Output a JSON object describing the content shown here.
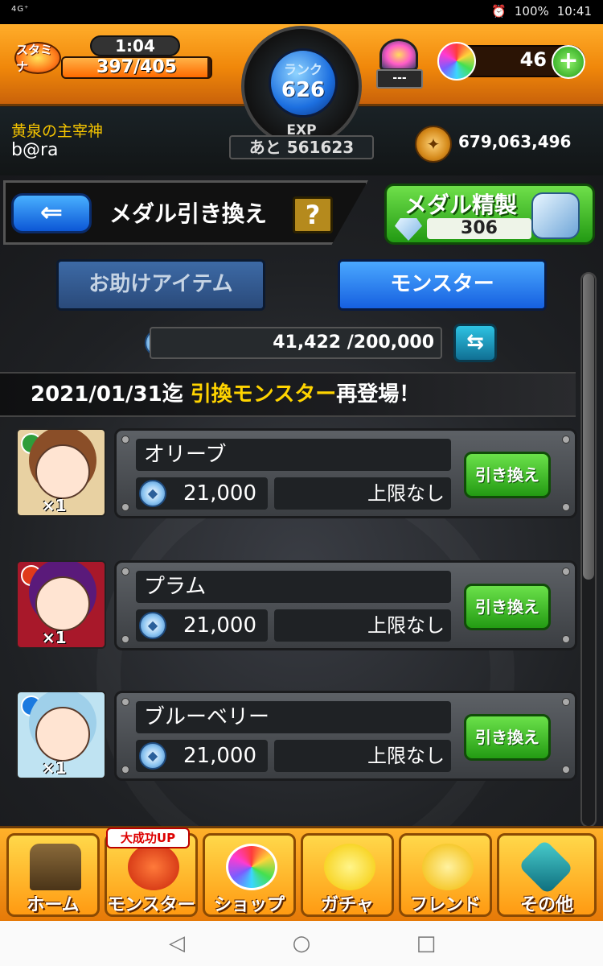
{
  "status_bar": {
    "network": "4G⁺",
    "battery": "100%",
    "time": "10:41"
  },
  "colors": {
    "accent_orange": "#f0870a",
    "button_green": "#229a13",
    "tab_blue": "#1660e0",
    "highlight_yellow": "#ffd400"
  },
  "header": {
    "stamina_badge": "スタミナ",
    "stamina_timer": "1:04",
    "stamina_value": "397/405",
    "stamina_fraction": 0.98,
    "rank_label": "ランク",
    "rank_value": "626",
    "exp_label": "EXP",
    "exp_remaining": "あと 561623",
    "helper_value": "---",
    "orb_count": "46",
    "plus_label": "+",
    "title": "黄泉の主宰神",
    "username": "b@ra",
    "coin_value": "679,063,496"
  },
  "nav": {
    "back_icon": "back-arrow-icon",
    "title": "メダル引き換え",
    "help_label": "?",
    "refine_label": "メダル精製",
    "refine_count": "306"
  },
  "tabs": {
    "items_label": "お助けアイテム",
    "monster_label": "モンスター",
    "active": "monster"
  },
  "medals": {
    "current": "41,422",
    "max": "200,000",
    "display": "41,422 /200,000",
    "swap_icon": "swap-icon"
  },
  "banner": {
    "date_text": "2021/01/31迄",
    "highlight_text": "引換モンスター",
    "suffix_text": "再登場！"
  },
  "exchange_list": [
    {
      "name": "オリーブ",
      "price": "21,000",
      "limit": "上限なし",
      "count": "×1",
      "button_label": "引き換え",
      "attr_color": "#2f9d3a",
      "bg": "#e8d1a2",
      "hair": "#8a4e28"
    },
    {
      "name": "プラム",
      "price": "21,000",
      "limit": "上限なし",
      "count": "×1",
      "button_label": "引き換え",
      "attr_color": "#e03a1a",
      "bg": "#a8182a",
      "hair": "#5a1a7a"
    },
    {
      "name": "ブルーベリー",
      "price": "21,000",
      "limit": "上限なし",
      "count": "×1",
      "button_label": "引き換え",
      "attr_color": "#1a7ae0",
      "bg": "#bfe3f2",
      "hair": "#9fd0ea"
    }
  ],
  "bottom_nav": {
    "badge": "大成功UP",
    "items": [
      {
        "label": "ホーム",
        "icon": "home-icon"
      },
      {
        "label": "モンスター",
        "icon": "monster-icon"
      },
      {
        "label": "ショップ",
        "icon": "shop-orb-icon"
      },
      {
        "label": "ガチャ",
        "icon": "gacha-egg-icon"
      },
      {
        "label": "フレンド",
        "icon": "friend-balloon-icon"
      },
      {
        "label": "その他",
        "icon": "other-icon"
      }
    ]
  }
}
